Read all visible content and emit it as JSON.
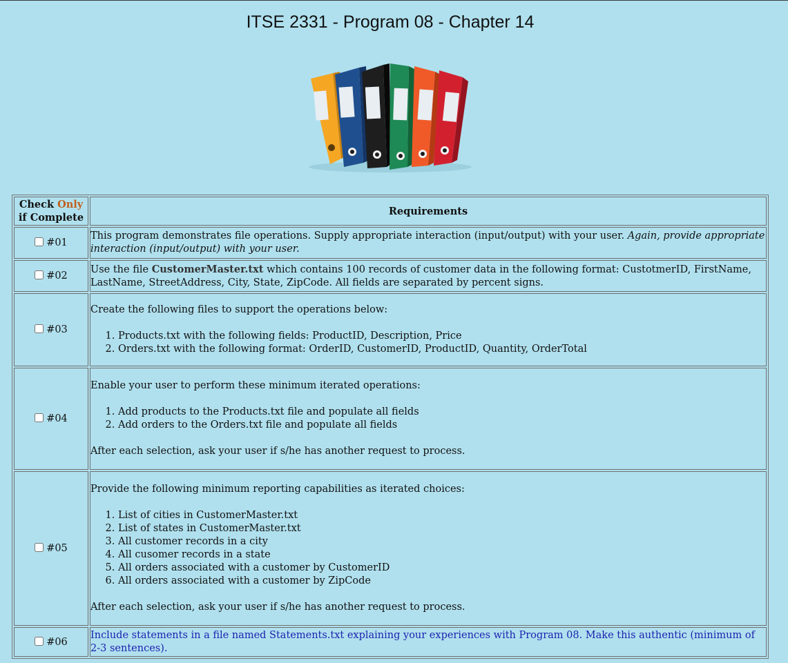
{
  "page": {
    "title": "ITSE 2331 - Program 08 - Chapter 14"
  },
  "image": {
    "icon": "binders-icon",
    "colors": [
      "#f5a623",
      "#1f4f8f",
      "#1e1e1e",
      "#1e8a55",
      "#f05a28",
      "#d3202f"
    ]
  },
  "table": {
    "check_header_part1": "Check",
    "check_header_only": "Only",
    "check_header_part2": "if Complete",
    "requirements_header": "Requirements",
    "rows": [
      {
        "id": "#01",
        "text_plain": "This program demonstrates file operations. Supply appropriate interaction (input/output) with your user.",
        "text_italic": "Again, provide appropriate interaction (input/output) with your user."
      },
      {
        "id": "#02",
        "pre": "Use the file",
        "file": "CustomerMaster.txt",
        "post": "which contains 100 records of customer data in the following format: CustotmerID, FirstName, LastName, StreetAddress, City, State, ZipCode. All fields are separated by percent signs."
      },
      {
        "id": "#03",
        "intro": "Create the following files to support the operations below:",
        "items": [
          "Products.txt with the following fields: ProductID, Description, Price",
          "Orders.txt with the following format: OrderID, CustomerID, ProductID, Quantity, OrderTotal"
        ]
      },
      {
        "id": "#04",
        "intro": "Enable your user to perform these minimum iterated operations:",
        "items": [
          "Add products to the Products.txt file and populate all fields",
          "Add orders to the Orders.txt file and populate all fields"
        ],
        "outro": "After each selection, ask your user if s/he has another request to process."
      },
      {
        "id": "#05",
        "intro": "Provide the following minimum reporting capabilities as iterated choices:",
        "items": [
          "List of cities in CustomerMaster.txt",
          "List of states in CustomerMaster.txt",
          "All customer records in a city",
          "All cusomer records in a state",
          "All orders associated with a customer by CustomerID",
          "All orders associated with a customer by ZipCode"
        ],
        "outro": "After each selection, ask your user if s/he has another request to process."
      },
      {
        "id": "#06",
        "text": "Include statements in a file named Statements.txt explaining your experiences with Program 08. Make this authentic (minimum of 2-3 sentences)."
      }
    ]
  }
}
